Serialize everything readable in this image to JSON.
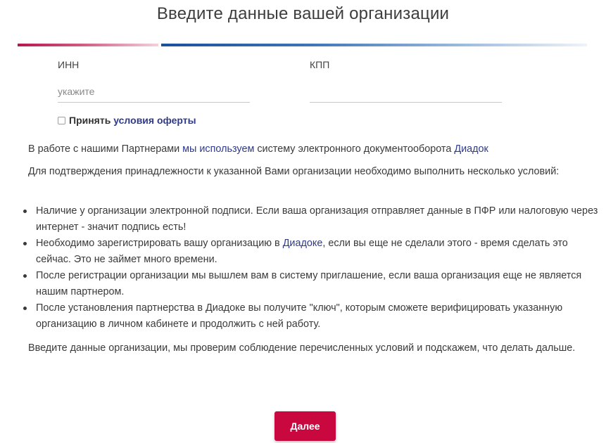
{
  "title": "Введите данные вашей организации",
  "form": {
    "inn_label": "ИНН",
    "inn_placeholder": "укажите",
    "inn_value": "",
    "kpp_label": "КПП",
    "kpp_placeholder": "",
    "kpp_value": "",
    "offer_prefix": "Принять ",
    "offer_link": "условия оферты",
    "offer_checked": false
  },
  "intro": {
    "part1": "В работе с нашими Партнерами ",
    "link1": "мы используем",
    "part2": " систему электронного документооборота ",
    "link2": "Диадок"
  },
  "conditions_intro": "Для подтверждения принадлежности к указанной Вами организации необходимо выполнить несколько условий:",
  "conditions": {
    "item1": "Наличие у организации электронной подписи. Если ваша организация отправляет данные в ПФР или налоговую через интернет - значит подпись есть!",
    "item2_prefix": "Необходимо зарегистрировать вашу организацию в ",
    "item2_link": "Диадоке",
    "item2_suffix": ", если вы еще не сделали этого - время сделать это сейчас. Это не займет много времени.",
    "item3": "После регистрации организации мы вышлем вам в систему приглашение, если ваша организация еще не является нашим партнером.",
    "item4": "После установления партнерства в Диадоке вы получите \"ключ\", которым сможете верифицировать указанную организацию в личном кабинете и продолжить с ней работу."
  },
  "outro": "Введите данные организации, мы проверим соблюдение перечисленных условий и подскажем, что делать дальше.",
  "submit_label": "Далее",
  "colors": {
    "accent_red": "#c8083f",
    "accent_blue": "#1a4f9c",
    "link": "#2f3b8a"
  }
}
